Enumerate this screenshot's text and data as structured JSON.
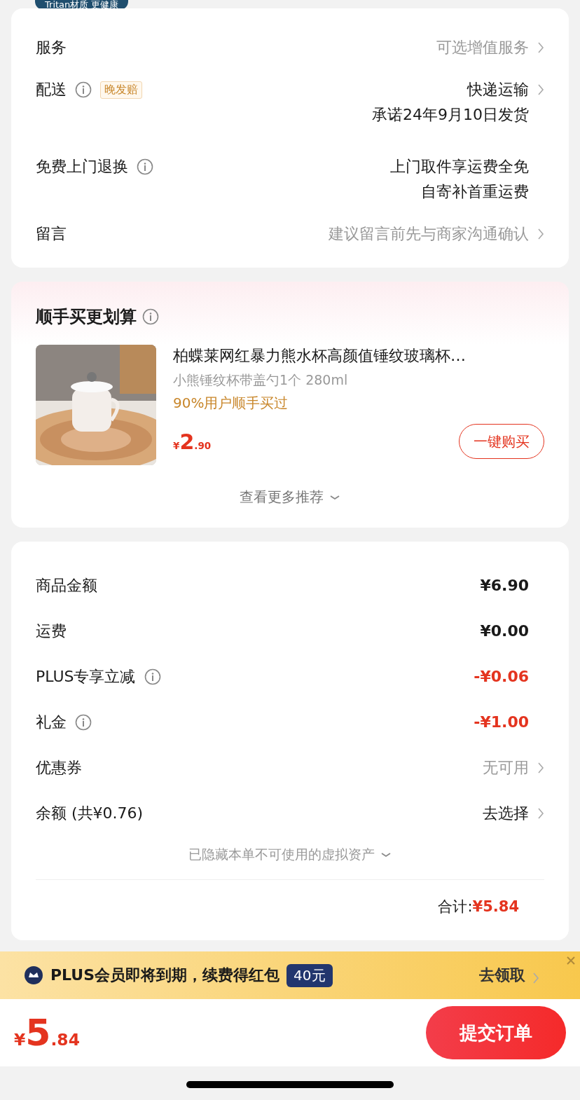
{
  "top_badge": {
    "text": "Tritan材质 更健康"
  },
  "order_rows": [
    {
      "label": "服务",
      "info": false,
      "tag": null,
      "lines": [
        "可选增值服务"
      ],
      "muted": true,
      "chevron": true
    },
    {
      "label": "配送",
      "info": true,
      "tag": "晚发赔",
      "lines": [
        "快递运输",
        "承诺24年9月10日发货"
      ],
      "muted": false,
      "chevron": true
    },
    {
      "label": "免费上门退换",
      "info": true,
      "tag": null,
      "lines": [
        "上门取件享运费全免",
        "自寄补首重运费"
      ],
      "muted": false,
      "chevron": false
    },
    {
      "label": "留言",
      "info": false,
      "tag": null,
      "lines": [
        "建议留言前先与商家沟通确认"
      ],
      "muted": true,
      "chevron": true
    }
  ],
  "upsell": {
    "title": "顺手买更划算",
    "info": true,
    "product": {
      "kind": "picture",
      "name": "柏蝶莱网红暴力熊水杯高颜值锤纹玻璃杯…",
      "spec": "小熊锤纹杯带盖勺1个 280ml",
      "social_proof": "90%用户顺手买过",
      "currency": "¥",
      "price_int": "2",
      "price_dec": ".90",
      "button": "一键购买"
    },
    "more": "查看更多推荐"
  },
  "costs": {
    "rows": [
      {
        "label": "商品金额",
        "info": false,
        "value": "¥6.90",
        "kind": "bold",
        "chevron": false
      },
      {
        "label": "运费",
        "info": false,
        "value": "¥0.00",
        "kind": "bold",
        "chevron": false
      },
      {
        "label": "PLUS专享立减",
        "info": true,
        "value": "-¥0.06",
        "kind": "red",
        "chevron": false
      },
      {
        "label": "礼金",
        "info": true,
        "value": "-¥1.00",
        "kind": "red",
        "chevron": false
      },
      {
        "label": "优惠券",
        "info": false,
        "value": "无可用",
        "kind": "grey",
        "chevron": true
      },
      {
        "label": "余额 (共¥0.76)",
        "info": false,
        "value": "去选择",
        "kind": "normal",
        "chevron": true
      }
    ],
    "hidden_note": "已隐藏本单不可使用的虚拟资产",
    "total_label": "合计:",
    "total_value": "¥5.84"
  },
  "banner": {
    "text": "PLUS会员即将到期，续费得红包",
    "badge": "40元",
    "action": "去领取",
    "closable": true
  },
  "footer": {
    "currency": "¥",
    "price_int": "5",
    "price_dec": ".84",
    "submit": "提交订单"
  }
}
